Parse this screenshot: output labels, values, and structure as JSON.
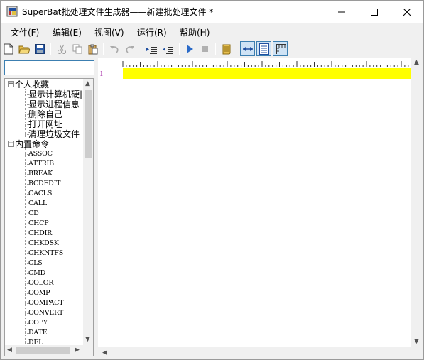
{
  "window": {
    "title": "SuperBat批处理文件生成器——新建批处理文件 *"
  },
  "menu": [
    "文件(F)",
    "编辑(E)",
    "视图(V)",
    "运行(R)",
    "帮助(H)"
  ],
  "toolbar": {
    "buttons": [
      "new-file",
      "open",
      "save",
      "cut",
      "copy",
      "paste",
      "undo",
      "redo",
      "indent",
      "outdent",
      "run",
      "stop",
      "script",
      "wrap",
      "list-view",
      "ruler"
    ]
  },
  "search": {
    "value": ""
  },
  "tree": {
    "favorites_label": "个人收藏",
    "favorites": [
      "显示计算机硬|",
      "显示进程信息",
      "删除自己",
      "打开网址",
      "清理垃圾文件"
    ],
    "builtins_label": "内置命令",
    "commands": [
      "ASSOC",
      "ATTRIB",
      "BREAK",
      "BCDEDIT",
      "CACLS",
      "CALL",
      "CD",
      "CHCP",
      "CHDIR",
      "CHKDSK",
      "CHKNTFS",
      "CLS",
      "CMD",
      "COLOR",
      "COMP",
      "COMPACT",
      "CONVERT",
      "COPY",
      "DATE",
      "DEL"
    ]
  },
  "editor": {
    "line_number": "1",
    "highlight_color": "#ffff00",
    "gutter_color": "#b040b0"
  }
}
